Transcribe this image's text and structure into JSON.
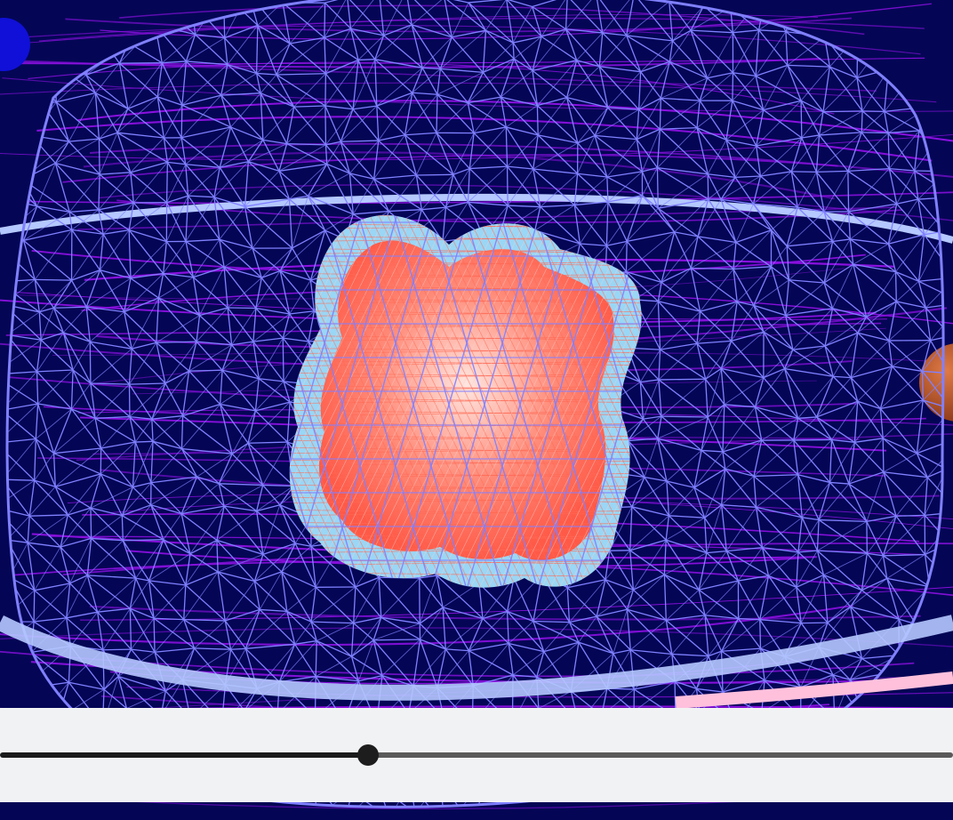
{
  "scene": {
    "background_color": "#040655",
    "outer_mesh_color": "#8080ff",
    "ring_color": "#b5c8ff",
    "orbit_color": "#8b10e0",
    "core_mesh_color": "#8fd0f5",
    "core_fill_color": "#ff6a55",
    "planet_left_color": "#1010d8",
    "planet_right_color": "#c0592e",
    "objects": [
      {
        "name": "outer-wireframe-shell",
        "icon": "mesh-sphere"
      },
      {
        "name": "inner-core-blob",
        "icon": "mesh-blob"
      },
      {
        "name": "equatorial-ring",
        "icon": "ring"
      },
      {
        "name": "left-planet",
        "icon": "sphere"
      },
      {
        "name": "right-planet",
        "icon": "sphere"
      }
    ]
  },
  "controls": {
    "slider": {
      "value_fraction": 0.386,
      "track_fill_color": "#1b1b1b",
      "track_rest_color": "#5a5a5a",
      "thumb_color": "#1d1d1d"
    }
  }
}
